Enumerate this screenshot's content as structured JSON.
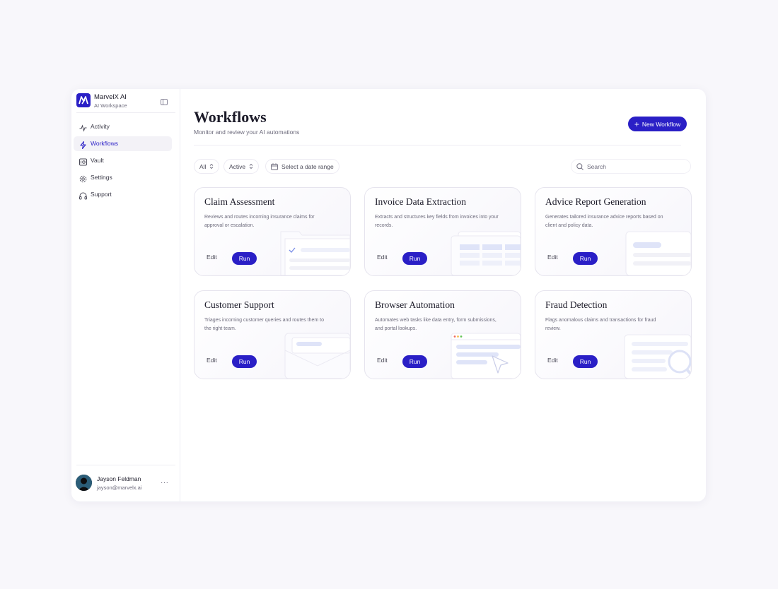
{
  "brand": {
    "name": "MarvelX AI",
    "subtitle": "AI Workspace"
  },
  "sidebar": {
    "items": [
      {
        "label": "Activity",
        "icon": "activity-icon"
      },
      {
        "label": "Workflows",
        "icon": "bolt-icon",
        "active": true
      },
      {
        "label": "Vault",
        "icon": "vault-icon"
      },
      {
        "label": "Settings",
        "icon": "gear-icon"
      },
      {
        "label": "Support",
        "icon": "headphones-icon"
      }
    ]
  },
  "user": {
    "name": "Jayson Feldman",
    "email": "jayson@marvelx.ai",
    "menu": "···"
  },
  "header": {
    "title": "Workflows",
    "subtitle": "Monitor and review your AI automations",
    "new_button": "New Workflow"
  },
  "filters": {
    "type": "All",
    "status": "Active",
    "date": "Select a date range",
    "search_placeholder": "Search"
  },
  "cards": [
    {
      "title": "Claim Assessment",
      "description": "Reviews and routes incoming insurance claims for approval or escalation.",
      "edit": "Edit",
      "run": "Run"
    },
    {
      "title": "Invoice Data Extraction",
      "description": "Extracts and structures key fields from invoices into your records.",
      "edit": "Edit",
      "run": "Run"
    },
    {
      "title": "Advice Report Generation",
      "description": "Generates tailored insurance advice reports based on client and policy data.",
      "edit": "Edit",
      "run": "Run"
    },
    {
      "title": "Customer Support",
      "description": "Triages incoming customer queries and routes them to the right team.",
      "edit": "Edit",
      "run": "Run"
    },
    {
      "title": "Browser Automation",
      "description": "Automates web tasks like data entry, form submissions, and portal lookups.",
      "edit": "Edit",
      "run": "Run"
    },
    {
      "title": "Fraud Detection",
      "description": "Flags anomalous claims and transactions for fraud review.",
      "edit": "Edit",
      "run": "Run"
    }
  ],
  "colors": {
    "accent": "#2a1fc6",
    "background": "#f8f7fb",
    "muted_text": "#6d6b7c"
  }
}
